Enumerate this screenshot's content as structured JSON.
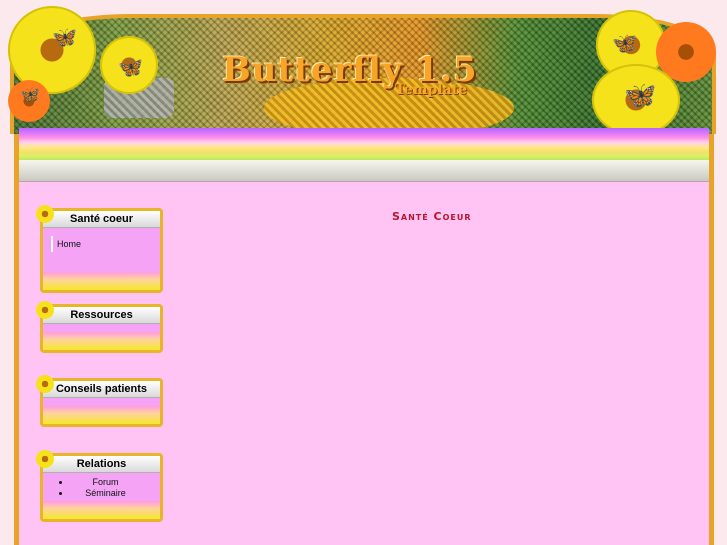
{
  "header": {
    "logo_main": "Butterfly 1.5",
    "logo_sub": "Template"
  },
  "page_title": "Santé Coeur",
  "sidebar": {
    "blocks": [
      {
        "title": "Santé coeur",
        "items": [
          "Home"
        ]
      },
      {
        "title": "Ressources",
        "items": []
      },
      {
        "title": "Conseils patients",
        "items": []
      },
      {
        "title": "Relations",
        "items": [
          "Forum",
          "Séminaire"
        ]
      }
    ]
  },
  "colors": {
    "content_bg": "#ffc4f4",
    "frame_border": "#e8a428",
    "title_color": "#b21830"
  }
}
